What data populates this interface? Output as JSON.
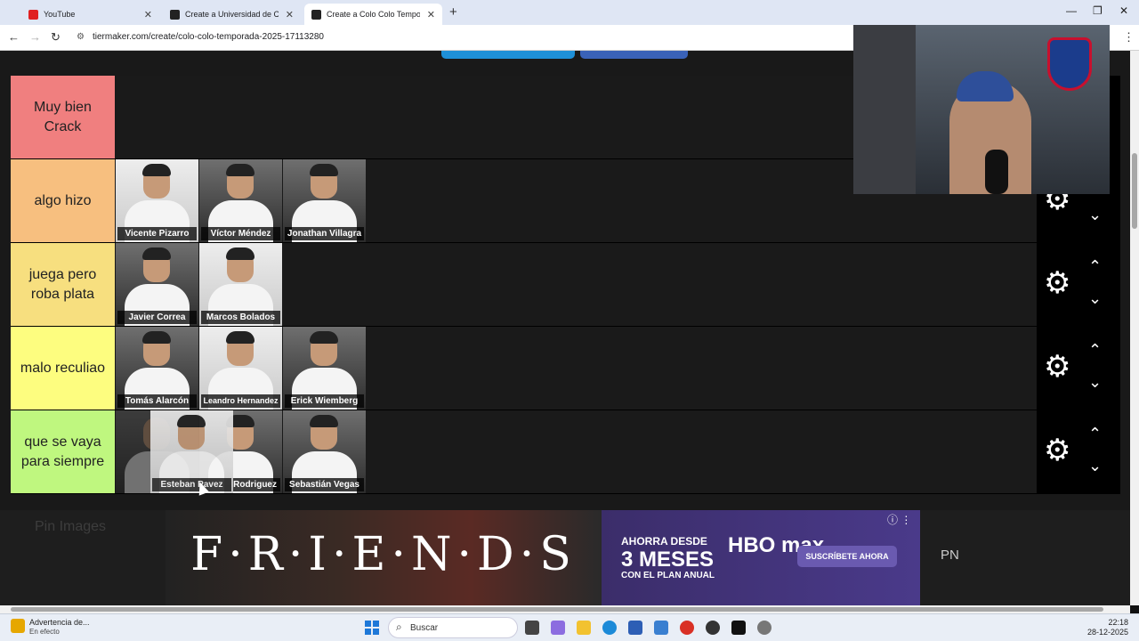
{
  "browser": {
    "tabs": [
      {
        "label": "YouTube"
      },
      {
        "label": "Create a Universidad de Chile T"
      },
      {
        "label": "Create a Colo Colo Temporada"
      }
    ],
    "url": "tiermaker.com/create/colo-colo-temporada-2025-17113280"
  },
  "tiers": [
    {
      "label": "Muy bien Crack",
      "color": "#f07f7f",
      "players": []
    },
    {
      "label": "algo hizo",
      "color": "#f7bf7f",
      "players": [
        "Vicente Pizarro",
        "Víctor Méndez",
        "Jonathan Villagra"
      ]
    },
    {
      "label": "juega pero roba plata",
      "color": "#f7df7f",
      "players": [
        "Javier Correa",
        "Marcos Bolados"
      ]
    },
    {
      "label": "malo reculiao",
      "color": "#fdfd7f",
      "players": [
        "Tomás Alarcón",
        "Leandro Hernandez",
        "Erick Wiemberg"
      ]
    },
    {
      "label": "que se vaya para siempre",
      "color": "#bff77f",
      "players": [
        "Esteban Pavez",
        "Rodriguez",
        "Sebastián Vegas"
      ]
    }
  ],
  "dragging": {
    "label": "Esteban Pavez"
  },
  "ads": {
    "pin_label": "Pin Images",
    "friends": "F·R·I·E·N·D·S",
    "hbo_line1": "AHORRA DESDE",
    "hbo_line2": "3 MESES",
    "hbo_line3": "CON EL PLAN ANUAL",
    "hbo_logo": "HBO max",
    "hbo_cta": "SUSCRÍBETE AHORA",
    "pn": "PN"
  },
  "taskbar": {
    "notice_title": "Advertencia de...",
    "notice_sub": "En efecto",
    "search": "Buscar",
    "time": "22:18",
    "date": "28-12-2025"
  },
  "colors": {
    "accent_blue": "#1e90d8"
  }
}
